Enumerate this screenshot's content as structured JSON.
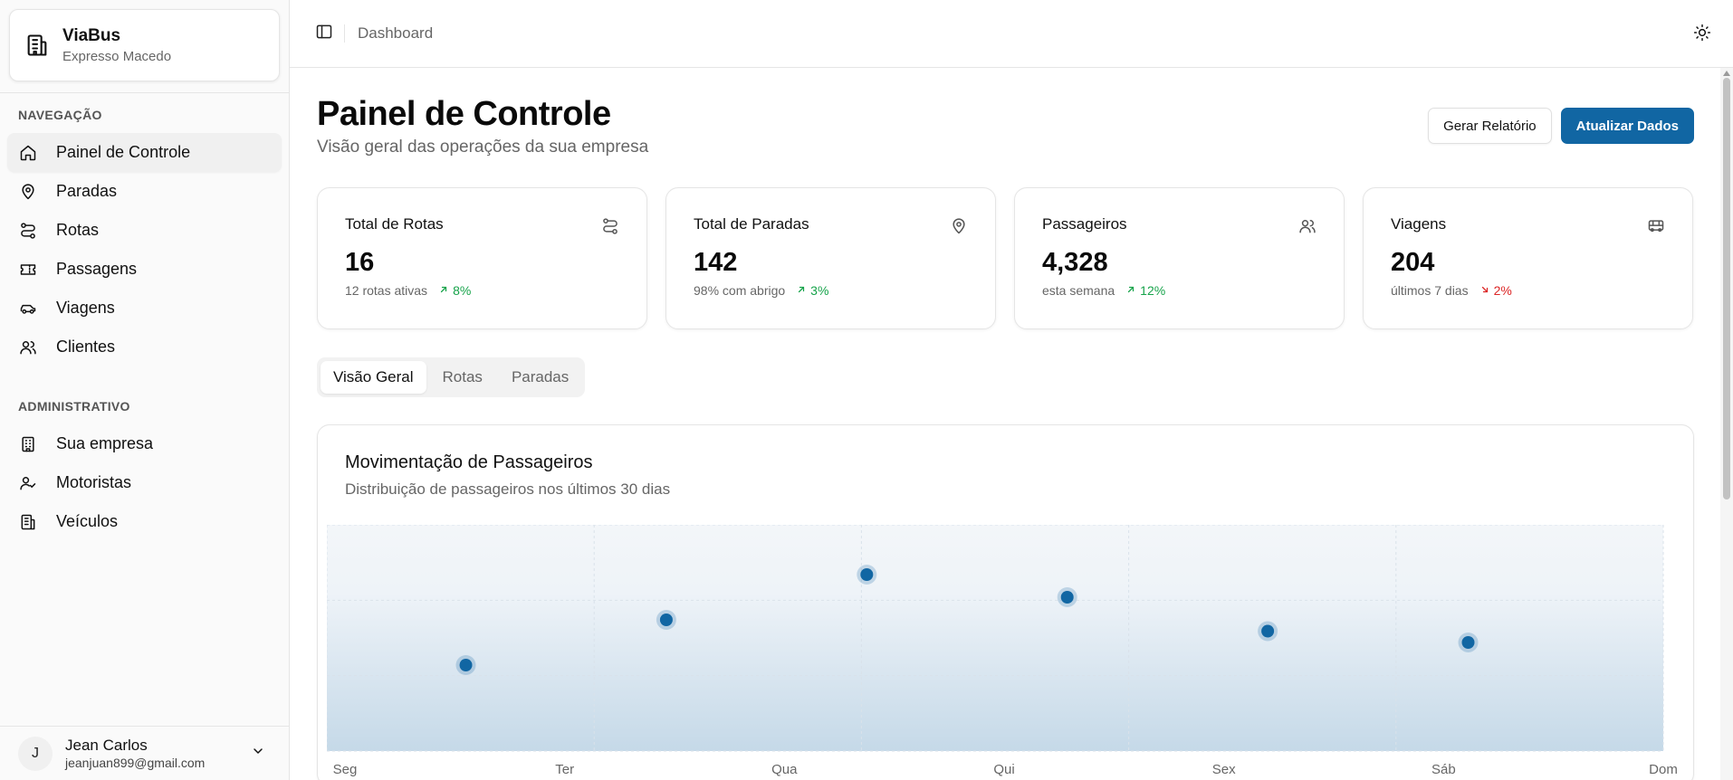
{
  "brand": {
    "name": "ViaBus",
    "company": "Expresso Macedo",
    "icon": "building-icon"
  },
  "sidebar": {
    "navigation_label": "NAVEGAÇÃO",
    "navigation": [
      {
        "label": "Painel de Controle",
        "icon": "home-icon",
        "active": true
      },
      {
        "label": "Paradas",
        "icon": "map-pin-icon"
      },
      {
        "label": "Rotas",
        "icon": "route-icon"
      },
      {
        "label": "Passagens",
        "icon": "ticket-icon"
      },
      {
        "label": "Viagens",
        "icon": "car-icon"
      },
      {
        "label": "Clientes",
        "icon": "users-icon"
      }
    ],
    "admin_label": "ADMINISTRATIVO",
    "admin": [
      {
        "label": "Sua empresa",
        "icon": "building-icon"
      },
      {
        "label": "Motoristas",
        "icon": "user-check-icon"
      },
      {
        "label": "Veículos",
        "icon": "vehicle-icon"
      }
    ]
  },
  "user": {
    "initial": "J",
    "name": "Jean Carlos",
    "email": "jeanjuan899@gmail.com"
  },
  "topbar": {
    "breadcrumb": "Dashboard"
  },
  "page": {
    "title": "Painel de Controle",
    "subtitle": "Visão geral das operações da sua empresa",
    "report_button": "Gerar Relatório",
    "refresh_button": "Atualizar Dados"
  },
  "stats": [
    {
      "title": "Total de Rotas",
      "value": "16",
      "note": "12 rotas ativas",
      "trend": "8%",
      "direction": "up",
      "icon": "route-icon"
    },
    {
      "title": "Total de Paradas",
      "value": "142",
      "note": "98% com abrigo",
      "trend": "3%",
      "direction": "up",
      "icon": "map-pin-icon"
    },
    {
      "title": "Passageiros",
      "value": "4,328",
      "note": "esta semana",
      "trend": "12%",
      "direction": "up",
      "icon": "users-icon"
    },
    {
      "title": "Viagens",
      "value": "204",
      "note": "últimos 7 dias",
      "trend": "2%",
      "direction": "down",
      "icon": "bus-icon"
    }
  ],
  "tabs": [
    {
      "label": "Visão Geral",
      "active": true
    },
    {
      "label": "Rotas"
    },
    {
      "label": "Paradas"
    }
  ],
  "colors": {
    "primary": "#1166a3",
    "trend_up": "#16a34a",
    "trend_down": "#dc2626"
  },
  "chart_card": {
    "title": "Movimentação de Passageiros",
    "subtitle": "Distribuição de passageiros nos últimos 30 dias"
  },
  "chart_data": {
    "type": "scatter",
    "categories": [
      "Seg",
      "Ter",
      "Qua",
      "Qui",
      "Sex",
      "Sáb",
      "Dom"
    ],
    "points": [
      {
        "x": 0.52,
        "y": 38
      },
      {
        "x": 1.27,
        "y": 58
      },
      {
        "x": 2.02,
        "y": 78
      },
      {
        "x": 2.77,
        "y": 68
      },
      {
        "x": 3.52,
        "y": 53
      },
      {
        "x": 4.27,
        "y": 48
      }
    ],
    "xlim": [
      0,
      5
    ],
    "ylim": [
      0,
      100
    ],
    "grid": true,
    "xlabel": "",
    "ylabel": ""
  }
}
